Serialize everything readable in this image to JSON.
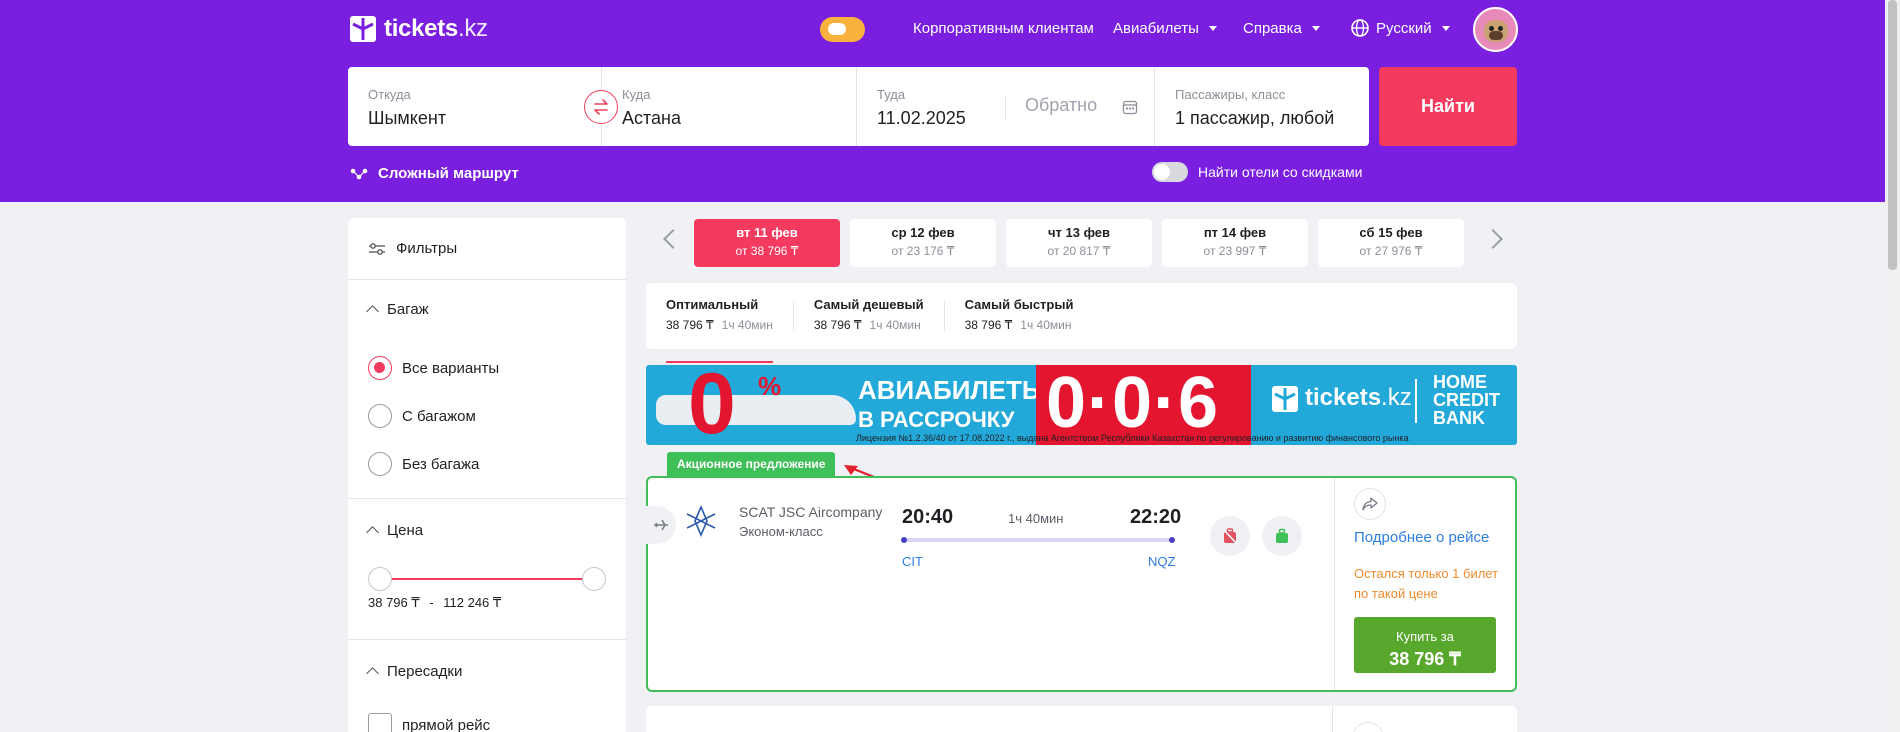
{
  "brand": {
    "logo_text": "tickets",
    "logo_domain": ".kz"
  },
  "nav": {
    "corporate": "Корпоративным клиентам",
    "avia": "Авиабилеты",
    "help": "Справка",
    "language": "Русский"
  },
  "search": {
    "from_label": "Откуда",
    "from_value": "Шымкент",
    "to_label": "Куда",
    "to_value": "Астана",
    "depart_label": "Туда",
    "depart_value": "11.02.2025",
    "return_placeholder": "Обратно",
    "passengers_label": "Пассажиры, класс",
    "passengers_value": "1 пассажир, любой",
    "find_label": "Найти",
    "complex_route": "Сложный маршрут",
    "hotels_toggle": "Найти отели со скидками"
  },
  "filters": {
    "title": "Фильтры",
    "baggage": {
      "title": "Багаж",
      "options": [
        "Все варианты",
        "С багажом",
        "Без багажа"
      ],
      "selected": 0
    },
    "price": {
      "title": "Цена",
      "min": "38 796 ₸",
      "separator": "-",
      "max": "112 246 ₸"
    },
    "transfers": {
      "title": "Пересадки",
      "options": [
        "прямой рейс"
      ]
    }
  },
  "dates": [
    {
      "day": "вт 11 фев",
      "price": "от 38 796 ₸",
      "active": true
    },
    {
      "day": "ср 12 фев",
      "price": "от 23 176 ₸"
    },
    {
      "day": "чт 13 фев",
      "price": "от 20 817 ₸"
    },
    {
      "day": "пт 14 фев",
      "price": "от 23 997 ₸"
    },
    {
      "day": "сб 15 фев",
      "price": "от 27 976 ₸"
    }
  ],
  "sorts": [
    {
      "title": "Оптимальный",
      "price": "38 796 ₸",
      "duration": "1ч 40мин"
    },
    {
      "title": "Самый дешевый",
      "price": "38 796 ₸",
      "duration": "1ч 40мин"
    },
    {
      "title": "Самый быстрый",
      "price": "38 796 ₸",
      "duration": "1ч 40мин"
    }
  ],
  "banner": {
    "zero": "0",
    "percent": "%",
    "line1": "АВИАБИЛЕТЫ",
    "line2": "В РАССРОЧКУ",
    "numbers": "0·0·6",
    "brand": "tickets",
    "brand_domain": ".kz",
    "bank_line1": "HOME",
    "bank_line2": "CREDIT",
    "bank_line3": "BANK",
    "license": "Лицензия №1.2.36/40 от 17.08.2022 г., выдана Агентством Республики Казахстан по регулированию и развитию финансового рынка"
  },
  "flight": {
    "promo": "Акционное предложение",
    "airline": "SCAT JSC Aircompany",
    "class": "Эконом-класс",
    "dep_time": "20:40",
    "arr_time": "22:20",
    "duration": "1ч 40мин",
    "dep_code": "CIT",
    "arr_code": "NQZ",
    "details": "Подробнее о рейсе",
    "left_notice": "Остался только 1 билет по такой цене",
    "buy_label": "Купить за",
    "buy_price": "38 796 ₸"
  },
  "colors": {
    "header": "#7a1fe0",
    "accent": "#f43b5f",
    "promo_green": "#3fbf57",
    "buy_green": "#58a82d",
    "link_blue": "#2e7ee0",
    "warning_orange": "#f08a2c"
  }
}
